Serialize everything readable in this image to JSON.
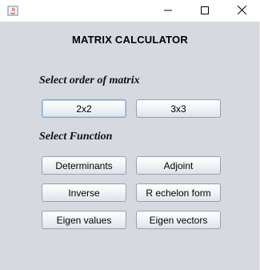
{
  "window": {
    "controls": [
      "minimize-icon",
      "maximize-icon",
      "close-icon"
    ]
  },
  "main": {
    "title": "MATRIX CALCULATOR",
    "order_label": "Select order of matrix",
    "order_buttons": [
      "2x2",
      "3x3"
    ],
    "function_label": "Select Function",
    "function_buttons": [
      "Determinants",
      "Adjoint",
      "Inverse",
      "R echelon form",
      "Eigen values",
      "Eigen vectors"
    ]
  }
}
